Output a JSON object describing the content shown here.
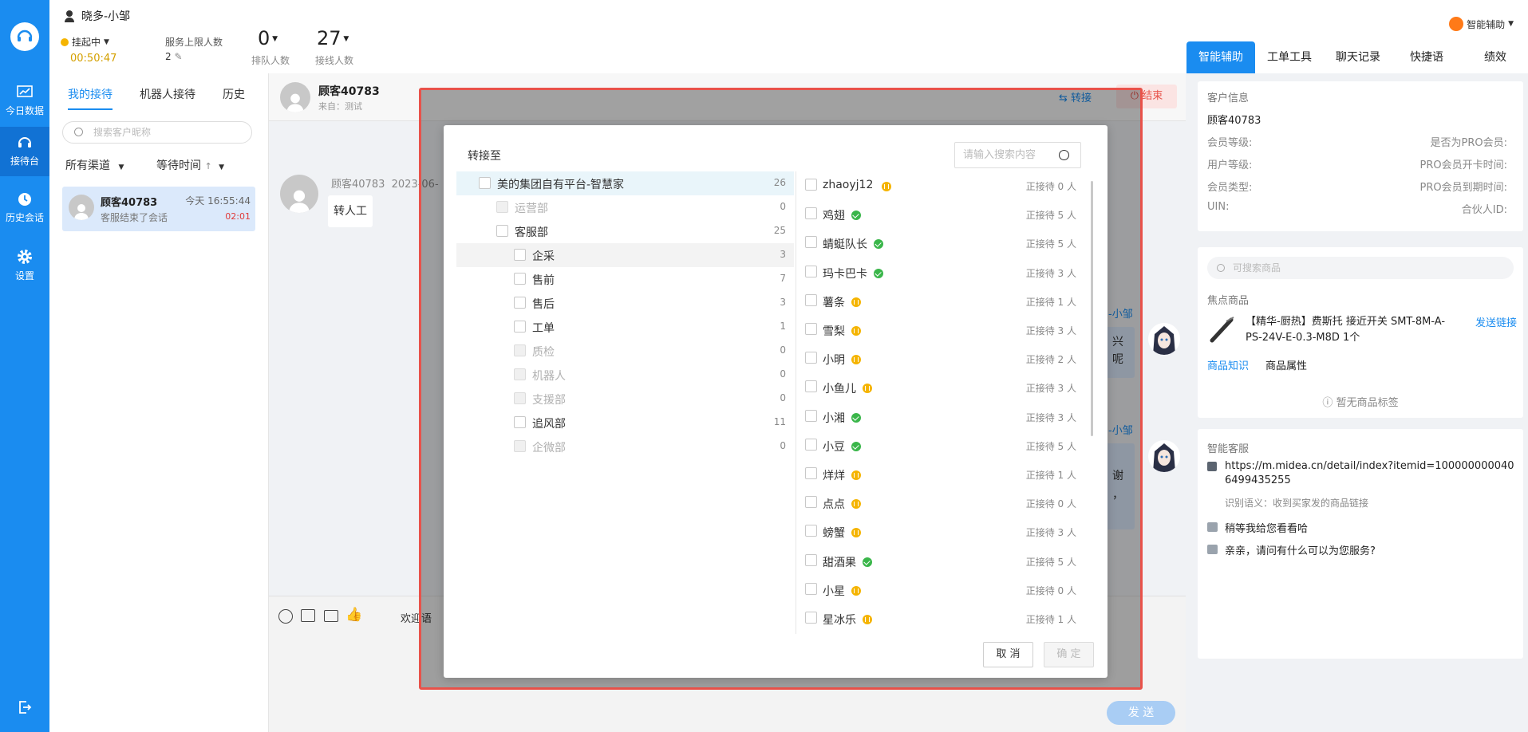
{
  "nav": {
    "items": [
      {
        "label": "今日数据",
        "icon": "chart-icon"
      },
      {
        "label": "接待台",
        "icon": "headset-icon"
      },
      {
        "label": "历史会话",
        "icon": "clock-icon"
      },
      {
        "label": "设置",
        "icon": "gear-icon"
      }
    ]
  },
  "header": {
    "agent_name": "晓多-小邹",
    "status": "挂起中",
    "timer": "00:50:47",
    "service_limit_label": "服务上限人数",
    "service_limit_value": "2",
    "queue_count": "0",
    "queue_label": "排队人数",
    "online_count": "27",
    "online_label": "接线人数",
    "assistant_label": "智能辅助"
  },
  "right_tabs": [
    "智能辅助",
    "工单工具",
    "聊天记录",
    "快捷语",
    "绩效"
  ],
  "list": {
    "tabs": [
      "我的接待",
      "机器人接待",
      "历史"
    ],
    "search_placeholder": "搜索客户昵称",
    "filter_channel": "所有渠道",
    "filter_wait": "等待时间",
    "conversation": {
      "name": "顾客40783",
      "time": "今天 16:55:44",
      "preview": "客服结束了会话",
      "duration": "02:01"
    }
  },
  "chat": {
    "customer_name": "顾客40783",
    "source": "来自：测试",
    "transfer_label": "转接",
    "end_label": "结束",
    "msg_sender": "顾客40783",
    "msg_time": "2023-06-",
    "msg_text": "转人工",
    "agent_label_1": "-小邹",
    "agent_label_2": "-小邹",
    "snip_1a": "兴",
    "snip_1b": "呢",
    "snip_2a": "谢",
    "snip_2b": "，",
    "welcome_label": "欢迎语",
    "send_label": "发 送"
  },
  "customer_info": {
    "title": "客户信息",
    "name": "顾客40783",
    "member_level": "会员等级:",
    "is_pro": "是否为PRO会员:",
    "user_level": "用户等级:",
    "pro_start": "PRO会员开卡时间:",
    "member_type": "会员类型:",
    "pro_end": "PRO会员到期时间:",
    "uin": "UIN:",
    "partner_id": "合伙人ID:"
  },
  "product": {
    "search_placeholder": "可搜索商品",
    "focus_label": "焦点商品",
    "title": "【精华-厨热】费斯托 接近开关 SMT-8M-A-PS-24V-E-0.3-M8D 1个",
    "send_link": "发送链接",
    "knowledge_tab": "商品知识",
    "attribute_tab": "商品属性",
    "no_tags": "暂无商品标签"
  },
  "smart_service": {
    "title": "智能客服",
    "link": "https://m.midea.cn/detail/index?itemid=1000000000406499435255",
    "intent": "识别语义：收到买家发的商品链接",
    "suggest_1": "稍等我给您看看哈",
    "suggest_2": "亲亲，请问有什么可以为您服务?"
  },
  "transfer_dialog": {
    "title": "转接至",
    "search_placeholder": "请输入搜索内容",
    "cancel": "取 消",
    "confirm": "确 定",
    "tree": [
      {
        "label": "美的集团自有平台-智慧家",
        "count": "26",
        "level": 0,
        "disabled": false
      },
      {
        "label": "运营部",
        "count": "0",
        "level": 1,
        "disabled": true
      },
      {
        "label": "客服部",
        "count": "25",
        "level": 1,
        "disabled": false
      },
      {
        "label": "企采",
        "count": "3",
        "level": 2,
        "disabled": false
      },
      {
        "label": "售前",
        "count": "7",
        "level": 2,
        "disabled": false
      },
      {
        "label": "售后",
        "count": "3",
        "level": 2,
        "disabled": false
      },
      {
        "label": "工单",
        "count": "1",
        "level": 2,
        "disabled": false
      },
      {
        "label": "质检",
        "count": "0",
        "level": 2,
        "disabled": true
      },
      {
        "label": "机器人",
        "count": "0",
        "level": 2,
        "disabled": true
      },
      {
        "label": "支援部",
        "count": "0",
        "level": 2,
        "disabled": true
      },
      {
        "label": "追风部",
        "count": "11",
        "level": 2,
        "disabled": false
      },
      {
        "label": "企微部",
        "count": "0",
        "level": 2,
        "disabled": true
      }
    ],
    "agents": [
      {
        "name": "zhaoyj12",
        "status": "busy",
        "count": "正接待 0 人"
      },
      {
        "name": "鸡翅",
        "status": "ok",
        "count": "正接待 5 人"
      },
      {
        "name": "蜻蜓队长",
        "status": "ok",
        "count": "正接待 5 人"
      },
      {
        "name": "玛卡巴卡",
        "status": "ok",
        "count": "正接待 3 人"
      },
      {
        "name": "薯条",
        "status": "busy",
        "count": "正接待 1 人"
      },
      {
        "name": "雪梨",
        "status": "busy",
        "count": "正接待 3 人"
      },
      {
        "name": "小明",
        "status": "busy",
        "count": "正接待 2 人"
      },
      {
        "name": "小鱼儿",
        "status": "busy",
        "count": "正接待 3 人"
      },
      {
        "name": "小湘",
        "status": "ok",
        "count": "正接待 3 人"
      },
      {
        "name": "小豆",
        "status": "ok",
        "count": "正接待 5 人"
      },
      {
        "name": "烊烊",
        "status": "busy",
        "count": "正接待 1 人"
      },
      {
        "name": "点点",
        "status": "busy",
        "count": "正接待 0 人"
      },
      {
        "name": "螃蟹",
        "status": "busy",
        "count": "正接待 3 人"
      },
      {
        "name": "甜酒果",
        "status": "ok",
        "count": "正接待 5 人"
      },
      {
        "name": "小星",
        "status": "busy",
        "count": "正接待 0 人"
      },
      {
        "name": "星冰乐",
        "status": "busy",
        "count": "正接待 1 人"
      }
    ]
  },
  "colors": {
    "primary": "#1a8cf0",
    "success": "#3ab64a",
    "warning": "#f5b400",
    "danger": "#e8524a"
  }
}
